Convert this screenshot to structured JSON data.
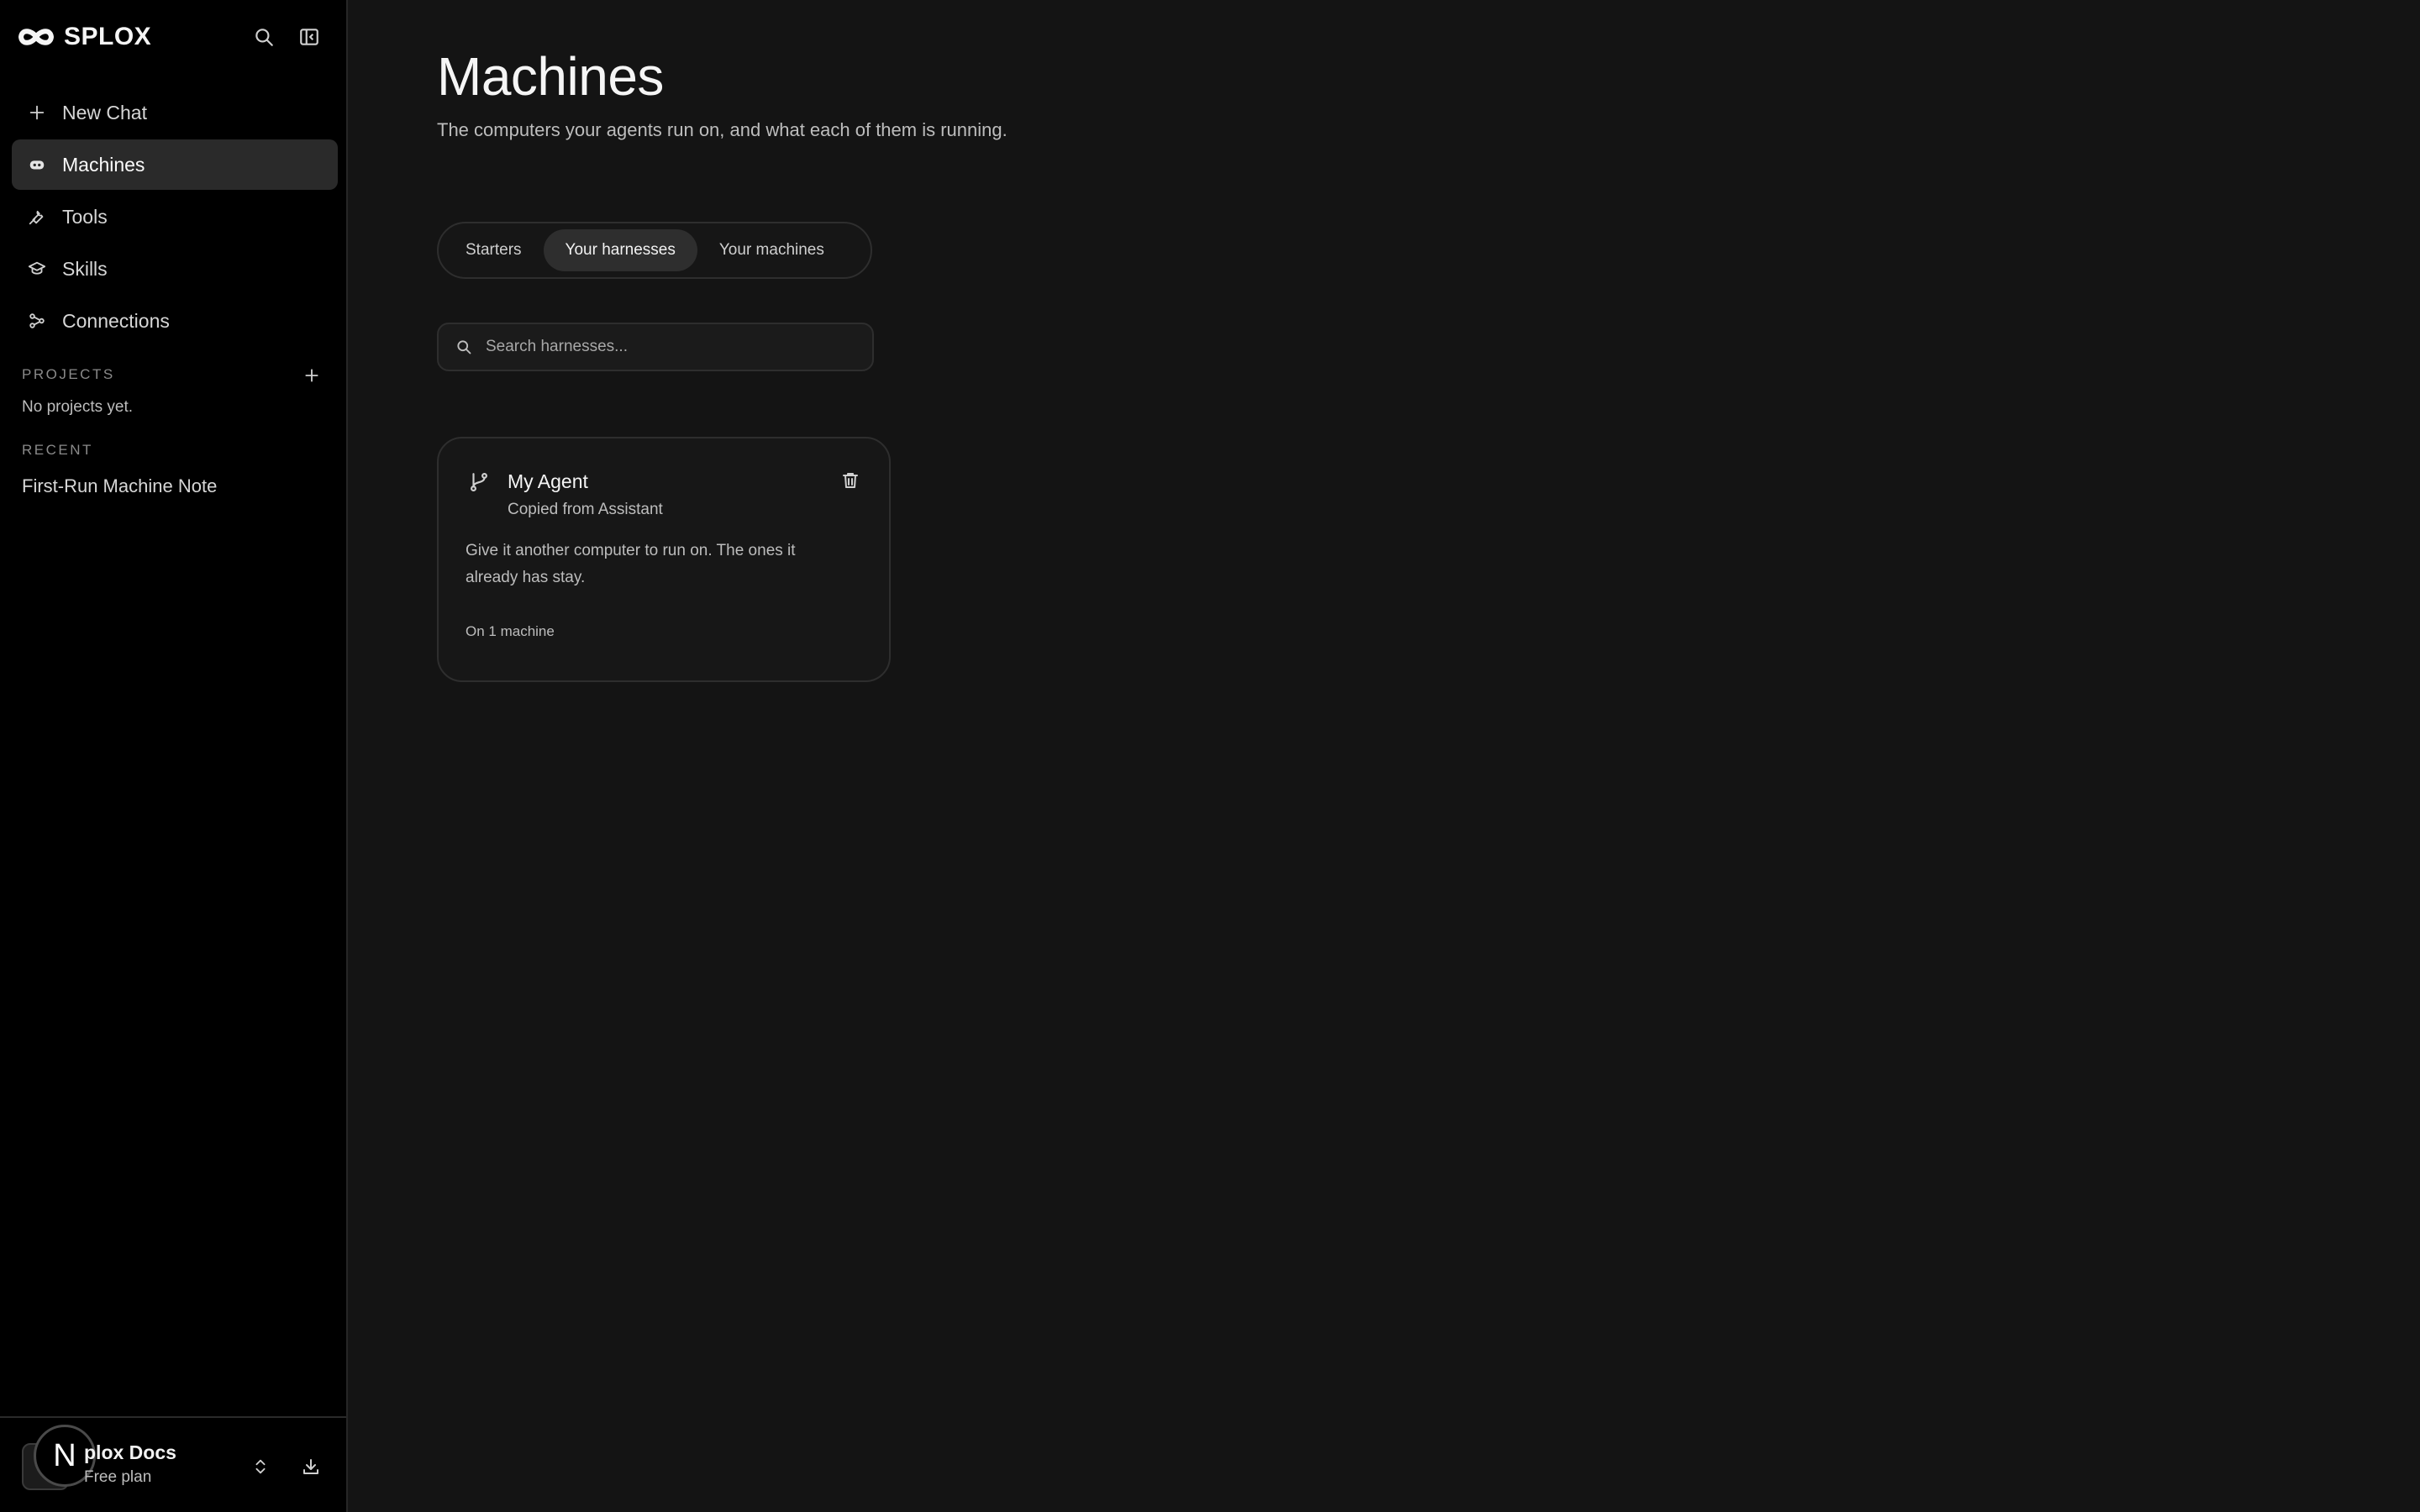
{
  "brand": {
    "name": "SPLOX",
    "logo_icon": "infinity-logo-icon"
  },
  "sidebar": {
    "top_icons": [
      {
        "name": "search-icon"
      },
      {
        "name": "collapse-sidebar-icon"
      }
    ],
    "items": [
      {
        "label": "New Chat",
        "icon": "plus-icon",
        "active": false
      },
      {
        "label": "Machines",
        "icon": "robot-icon",
        "active": true
      },
      {
        "label": "Tools",
        "icon": "wrench-icon",
        "active": false
      },
      {
        "label": "Skills",
        "icon": "graduation-cap-icon",
        "active": false
      },
      {
        "label": "Connections",
        "icon": "connections-icon",
        "active": false
      }
    ],
    "projects_label": "PROJECTS",
    "projects_empty": "No projects yet.",
    "recent_label": "RECENT",
    "recent_items": [
      {
        "label": "First-Run Machine Note"
      }
    ]
  },
  "account": {
    "avatar_letter": "N",
    "name": "plox Docs",
    "plan": "Free plan"
  },
  "main": {
    "title": "Machines",
    "subtitle": "The computers your agents run on, and what each of them is running.",
    "tabs": [
      {
        "label": "Starters",
        "active": false
      },
      {
        "label": "Your harnesses",
        "active": true
      },
      {
        "label": "Your machines",
        "active": false
      }
    ],
    "search": {
      "placeholder": "Search harnesses...",
      "value": ""
    },
    "cards": [
      {
        "title": "My Agent",
        "subtitle": "Copied from Assistant",
        "description": "Give it another computer to run on. The ones it already has stay.",
        "meta": "On 1 machine"
      }
    ]
  },
  "colors": {
    "background": "#141414",
    "sidebar": "#000000",
    "active_item": "#2a2a2a",
    "border": "#2e2e2e",
    "text_primary": "#f2f2f2",
    "text_secondary": "#bdbdbd"
  }
}
